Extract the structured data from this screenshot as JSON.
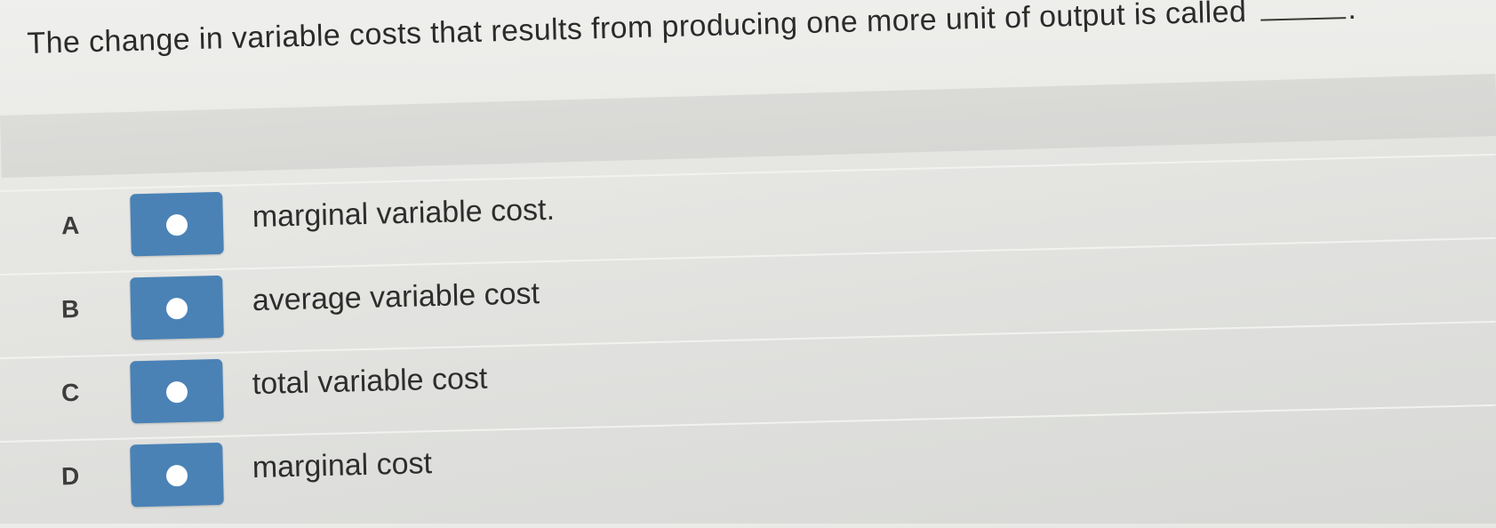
{
  "question": {
    "text": "The change in variable costs that results from producing one more unit of output is called",
    "blank": "______",
    "end_punctuation": "."
  },
  "options": [
    {
      "letter": "A",
      "text": "marginal variable cost."
    },
    {
      "letter": "B",
      "text": "average variable cost"
    },
    {
      "letter": "C",
      "text": "total variable cost"
    },
    {
      "letter": "D",
      "text": "marginal cost"
    }
  ],
  "colors": {
    "radio_box": "#4a82b6",
    "radio_dot": "#ffffff",
    "background": "#e6e6e3"
  }
}
